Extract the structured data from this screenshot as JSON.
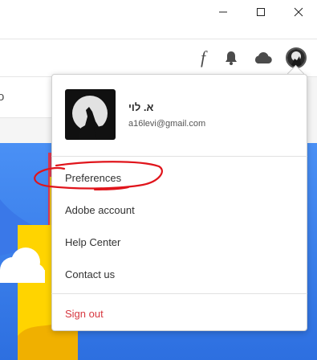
{
  "window_controls": {
    "minimize": "minimize-icon",
    "maximize": "maximize-icon",
    "close": "close-icon"
  },
  "header": {
    "icons": [
      "fonts-icon",
      "bell-icon",
      "cloud-icon",
      "avatar-icon"
    ],
    "font_glyph": "f"
  },
  "background": {
    "partial_text": "o"
  },
  "account_menu": {
    "user_name": "א. לוי",
    "user_email": "a16levi@gmail.com",
    "items": [
      {
        "label": "Preferences"
      },
      {
        "label": "Adobe account"
      },
      {
        "label": "Help Center"
      },
      {
        "label": "Contact us"
      }
    ],
    "sign_out": "Sign out"
  },
  "colors": {
    "sign_out": "#d7373f",
    "annotation": "#e0141b",
    "hero_blue": "#2d7ff9",
    "hero_yellow": "#ffd400"
  }
}
